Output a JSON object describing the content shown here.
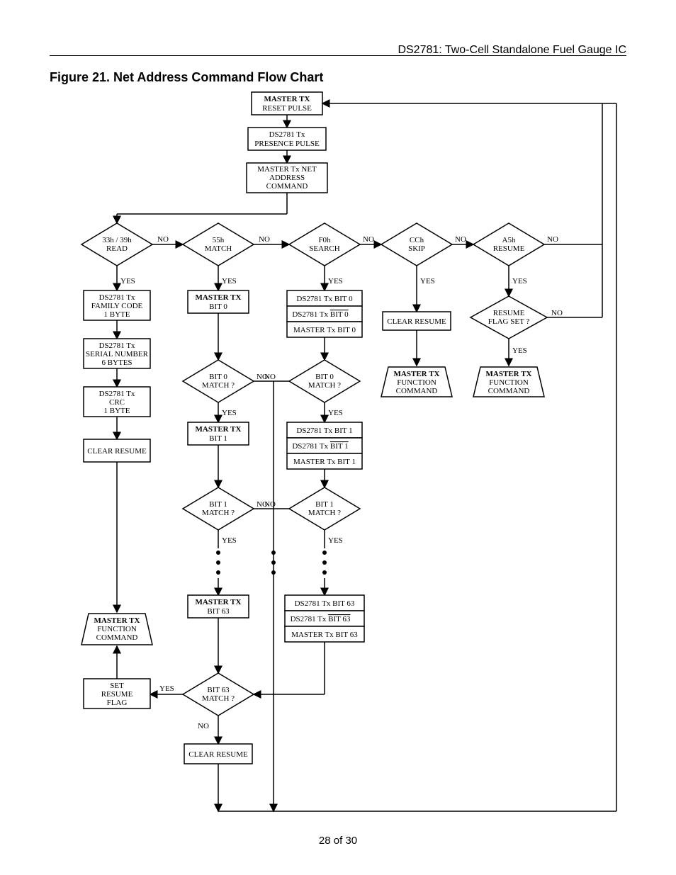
{
  "header": "DS2781: Two-Cell Standalone Fuel Gauge IC",
  "title": "Figure 21. Net Address Command Flow Chart",
  "footer": "28 of 30",
  "n": {
    "resetTx": {
      "t": "MASTER TX",
      "s": "RESET PULSE"
    },
    "presence": {
      "t": "DS2781 Tx",
      "s": "PRESENCE PULSE"
    },
    "netcmd": {
      "t": "MASTER Tx NET",
      "s": "ADDRESS",
      "u": "COMMAND"
    },
    "d33": {
      "t": "33h / 39h",
      "s": "READ"
    },
    "d55": {
      "t": "55h",
      "s": "MATCH"
    },
    "df0": {
      "t": "F0h",
      "s": "SEARCH"
    },
    "dcc": {
      "t": "CCh",
      "s": "SKIP"
    },
    "da5": {
      "t": "A5h",
      "s": "RESUME"
    },
    "fam": {
      "t": "DS2781 Tx",
      "s": "FAMILY CODE",
      "u": "1 BYTE"
    },
    "mtxb0": {
      "t": "MASTER TX",
      "s": "BIT 0"
    },
    "ser": {
      "t": "DS2781 Tx",
      "s": "SERIAL NUMBER",
      "u": "6 BYTES"
    },
    "crc": {
      "t": "DS2781 Tx",
      "s": "CRC",
      "u": "1 BYTE"
    },
    "clr1": {
      "t": "CLEAR RESUME"
    },
    "b0m1": {
      "t": "BIT 0",
      "s": "MATCH ?"
    },
    "b0m2": {
      "t": "BIT 0",
      "s": "MATCH ?"
    },
    "mtxb1": {
      "t": "MASTER TX",
      "s": "BIT 1"
    },
    "b1m1": {
      "t": "BIT 1",
      "s": "MATCH ?"
    },
    "b1m2": {
      "t": "BIT 1",
      "s": "MATCH ?"
    },
    "mtxb63": {
      "t": "MASTER TX",
      "s": "BIT 63"
    },
    "txbit0a": "DS2781 Tx BIT 0",
    "txbit0b": "DS2781 Tx BIT 0",
    "txbit0c": "MASTER Tx BIT 0",
    "txbit1a": "DS2781 Tx BIT 1",
    "txbit1b": "DS2781 Tx BIT 1",
    "txbit1c": "MASTER Tx BIT 1",
    "txbit63a": "DS2781 Tx BIT 63",
    "txbit63b": "DS2781 Tx BIT 63",
    "txbit63c": "MASTER Tx BIT 63",
    "clrres": {
      "t": "CLEAR RESUME"
    },
    "resflag": {
      "t": "RESUME",
      "s": "FLAG SET ?"
    },
    "mtxfn1": {
      "t": "MASTER TX",
      "s": "FUNCTION",
      "u": "COMMAND"
    },
    "mtxfn2": {
      "t": "MASTER TX",
      "s": "FUNCTION",
      "u": "COMMAND"
    },
    "mtxfn3": {
      "t": "MASTER TX",
      "s": "FUNCTION",
      "u": "COMMAND"
    },
    "setres": {
      "t": "SET",
      "s": "RESUME",
      "u": "FLAG"
    },
    "b63m": {
      "t": "BIT 63",
      "s": "MATCH ?"
    },
    "clr2": {
      "t": "CLEAR RESUME"
    }
  },
  "labels": {
    "yes": "YES",
    "no": "NO"
  }
}
